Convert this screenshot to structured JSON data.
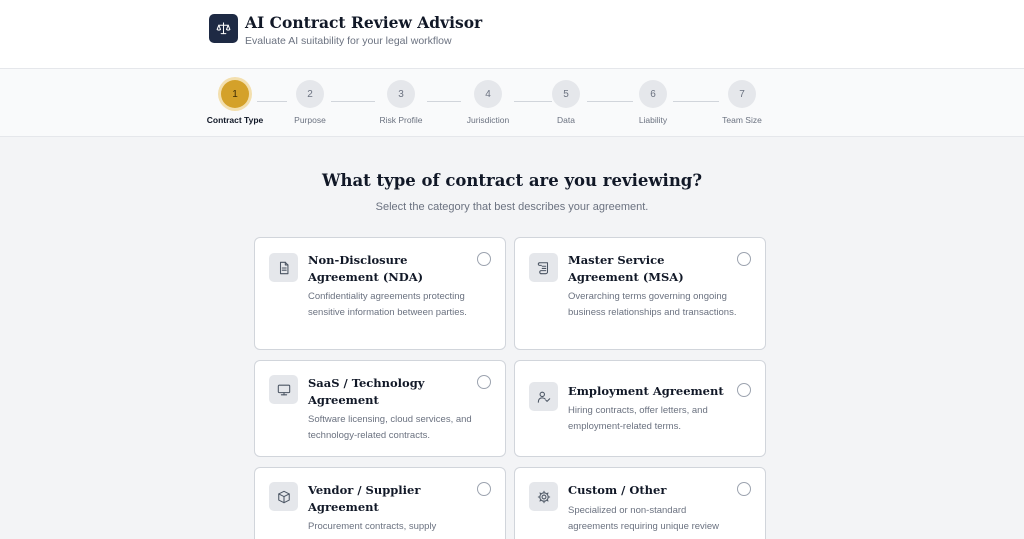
{
  "app": {
    "title": "AI Contract Review Advisor",
    "subtitle": "Evaluate AI suitability for your legal workflow",
    "logo_icon": "scale-icon"
  },
  "steps": [
    {
      "number": "1",
      "label": "Contract Type",
      "active": true
    },
    {
      "number": "2",
      "label": "Purpose",
      "active": false
    },
    {
      "number": "3",
      "label": "Risk Profile",
      "active": false
    },
    {
      "number": "4",
      "label": "Jurisdiction",
      "active": false
    },
    {
      "number": "5",
      "label": "Data",
      "active": false
    },
    {
      "number": "6",
      "label": "Liability",
      "active": false
    },
    {
      "number": "7",
      "label": "Team Size",
      "active": false
    }
  ],
  "question": {
    "title": "What type of contract are you reviewing?",
    "subtitle": "Select the category that best describes your agreement."
  },
  "options": [
    {
      "title": "Non-Disclosure Agreement (NDA)",
      "description": "Confidentiality agreements protecting sensitive information between parties.",
      "icon": "document-icon"
    },
    {
      "title": "Master Service Agreement (MSA)",
      "description": "Overarching terms governing ongoing business relationships and transactions.",
      "icon": "scroll-icon"
    },
    {
      "title": "SaaS / Technology Agreement",
      "description": "Software licensing, cloud services, and technology-related contracts.",
      "icon": "monitor-icon"
    },
    {
      "title": "Employment Agreement",
      "description": "Hiring contracts, offer letters, and employment-related terms.",
      "icon": "user-check-icon"
    },
    {
      "title": "Vendor / Supplier Agreement",
      "description": "Procurement contracts, supply",
      "icon": "package-icon"
    },
    {
      "title": "Custom / Other",
      "description": "Specialized or non-standard agreements requiring unique review",
      "icon": "gear-icon"
    }
  ],
  "colors": {
    "accent": "#d4a12a",
    "logo_bg": "#1e2a44",
    "page_bg": "#f3f4f6"
  }
}
